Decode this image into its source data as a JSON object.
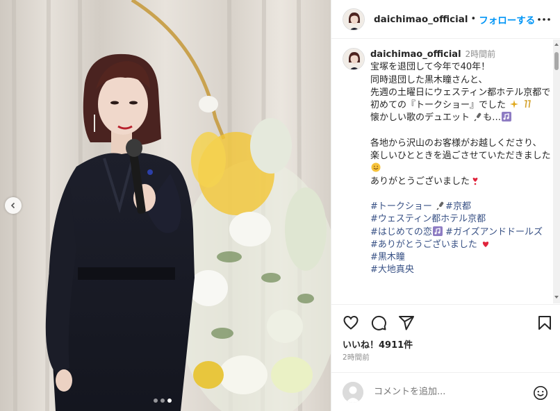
{
  "post": {
    "username": "daichimao_official",
    "separator": "•",
    "follow_label": "フォローする"
  },
  "caption": {
    "username": "daichimao_official",
    "time": "2時間前",
    "lines": [
      "宝塚を退団して今年で40年！",
      "同時退団した黒木瞳さんと、",
      "先週の土曜日にウェスティン都ホテル京都で",
      "初めての『トークショー』でした",
      "懐かしい歌のデュエット",
      "各地から沢山のお客様がお越しくださり、",
      "楽しいひとときを過ごさせていただきました",
      "ありがとうございました"
    ],
    "line6_suffix": "も…",
    "hashtags": [
      "#トークショー",
      "#京都",
      "#ウェスティン都ホテル京都",
      "#はじめての恋",
      "#ガイズアンドドールズ",
      "#ありがとうございました",
      "#黒木瞳",
      "#大地真央"
    ]
  },
  "icons": [
    "more-icon",
    "heart-icon",
    "comment-icon",
    "share-icon",
    "bookmark-icon",
    "smile-icon",
    "chevron-left-icon"
  ],
  "likes": "いいね！4911件",
  "posted_time": "2時間前",
  "comment_placeholder": "コメントを追加...",
  "carousel": {
    "count": 3,
    "active": 3
  },
  "colors": {
    "accent": "#0095f6",
    "hashtag": "#385185",
    "muted": "#8e8e8e"
  }
}
